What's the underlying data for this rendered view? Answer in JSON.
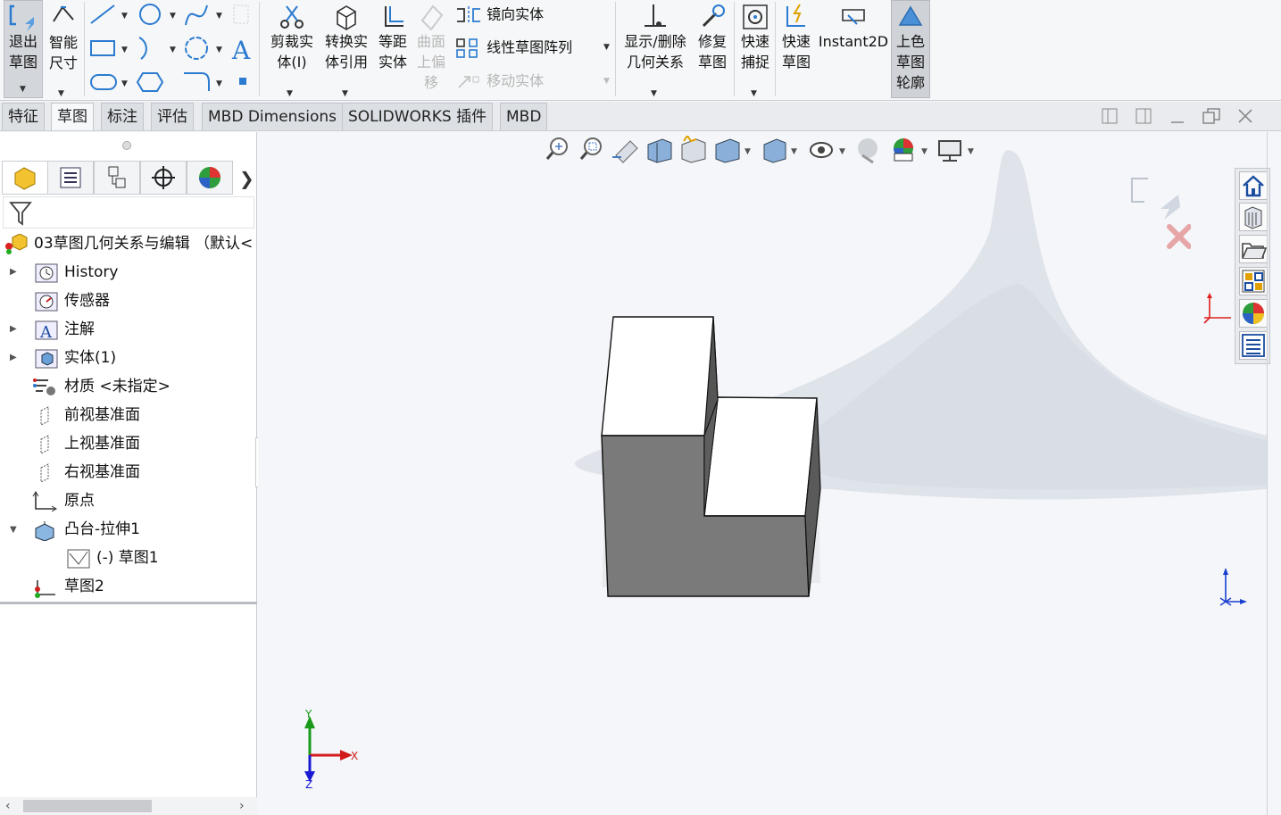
{
  "ribbon": {
    "exit_sketch": [
      "退出",
      "草图"
    ],
    "smart_dim": [
      "智能",
      "尺寸"
    ],
    "trim": [
      "剪裁实",
      "体(I)"
    ],
    "convert": [
      "转换实",
      "体引用"
    ],
    "offset": [
      "等距",
      "实体"
    ],
    "surface_offset": [
      "曲面",
      "上偏",
      "移"
    ],
    "mirror": "镜向实体",
    "linear_pattern": "线性草图阵列",
    "move": "移动实体",
    "display_relations": [
      "显示/删除",
      "几何关系"
    ],
    "repair": [
      "修复",
      "草图"
    ],
    "quick_snap": [
      "快速",
      "捕捉"
    ],
    "rapid_sketch": [
      "快速",
      "草图"
    ],
    "instant2d": "Instant2D",
    "shaded_contours": [
      "上色",
      "草图",
      "轮廓"
    ]
  },
  "tabs": [
    "特征",
    "草图",
    "标注",
    "评估",
    "MBD Dimensions",
    "SOLIDWORKS 插件",
    "MBD"
  ],
  "tree": {
    "root": "03草图几何关系与编辑 （默认<",
    "items": [
      {
        "label": "History"
      },
      {
        "label": "传感器"
      },
      {
        "label": "注解"
      },
      {
        "label": "实体(1)"
      },
      {
        "label": "材质 <未指定>"
      },
      {
        "label": "前视基准面"
      },
      {
        "label": "上视基准面"
      },
      {
        "label": "右视基准面"
      },
      {
        "label": "原点"
      },
      {
        "label": "凸台-拉伸1"
      },
      {
        "label": "(-) 草图1"
      },
      {
        "label": "草图2"
      }
    ]
  },
  "triad": {
    "x": "X",
    "y": "Y",
    "z": "Z"
  },
  "colors": {
    "accent": "#1b6ec2",
    "shaded_face": "#7a7a7a",
    "tab_active": "#f7f8fa"
  }
}
